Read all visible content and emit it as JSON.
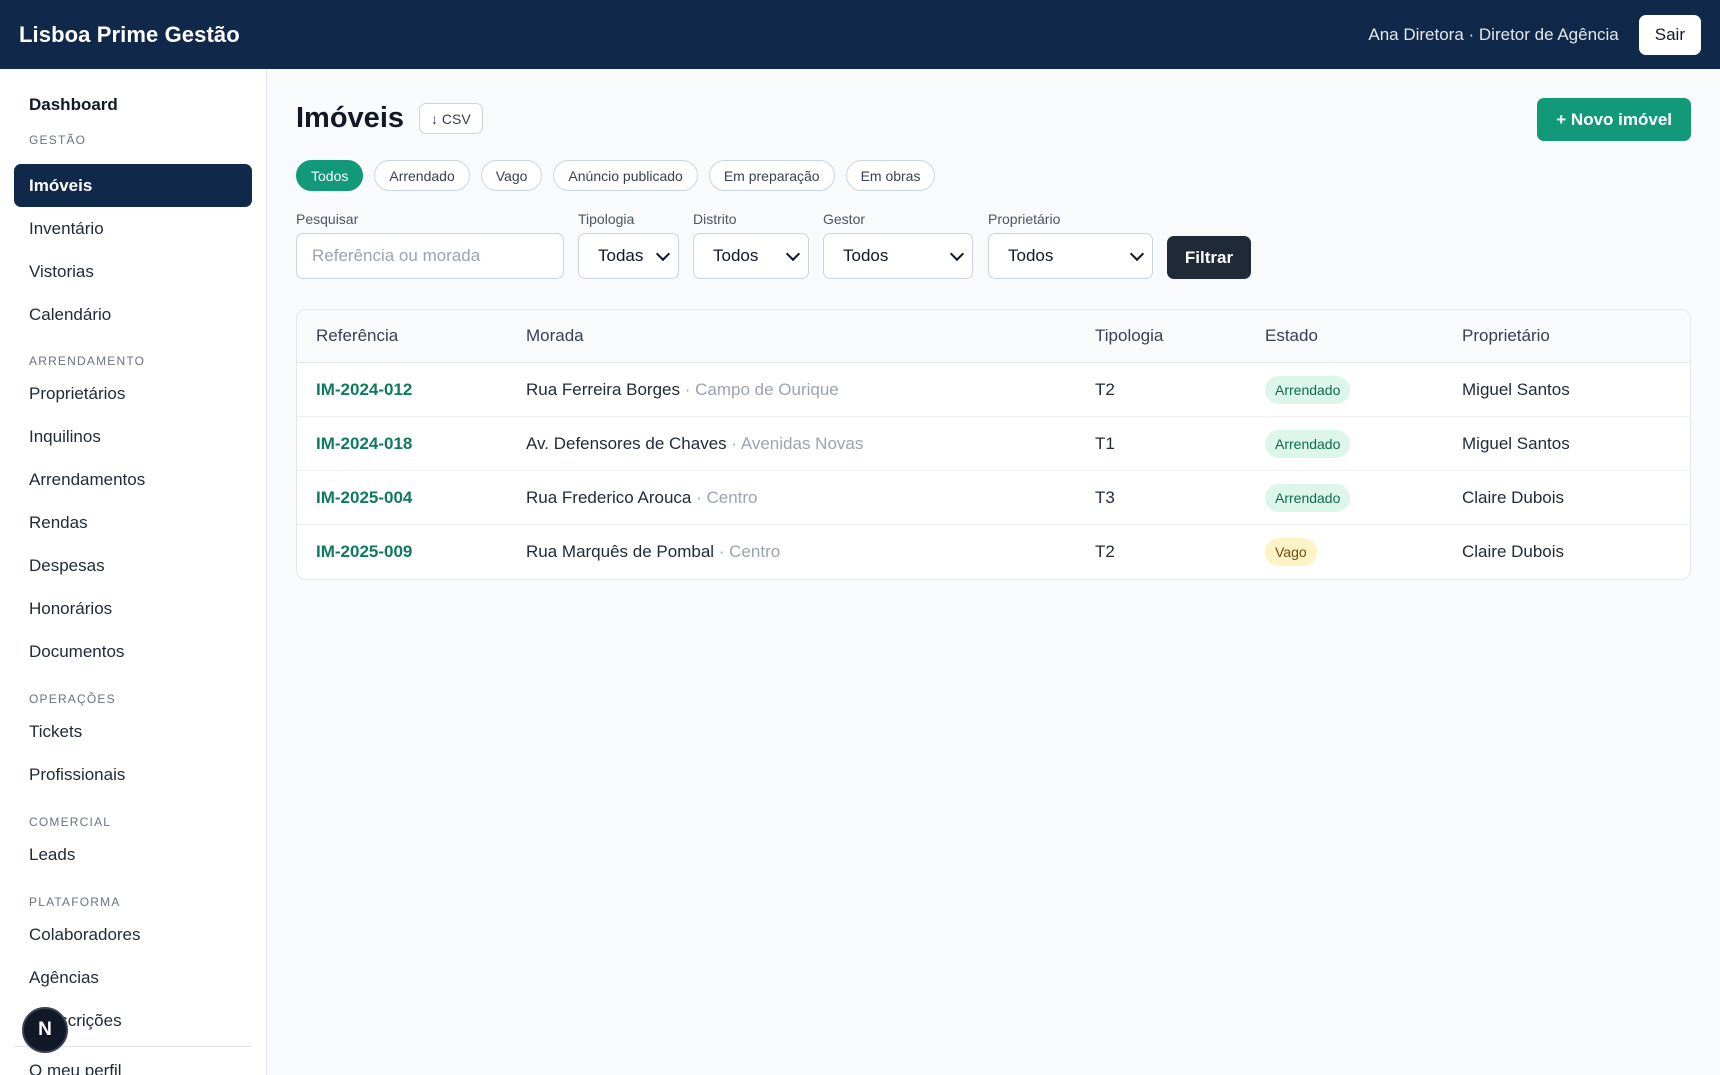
{
  "header": {
    "brand": "Lisboa Prime Gestão",
    "user": "Ana Diretora · Diretor de Agência",
    "logout_label": "Sair"
  },
  "sidebar": {
    "dashboard": "Dashboard",
    "sections": {
      "gestao": "GESTÃO",
      "arrendamento": "ARRENDAMENTO",
      "operacoes": "OPERAÇÕES",
      "comercial": "COMERCIAL",
      "plataforma": "PLATAFORMA"
    },
    "items": {
      "imoveis": "Imóveis",
      "inventario": "Inventário",
      "vistorias": "Vistorias",
      "calendario": "Calendário",
      "proprietarios": "Proprietários",
      "inquilinos": "Inquilinos",
      "arrendamentos": "Arrendamentos",
      "rendas": "Rendas",
      "despesas": "Despesas",
      "honorarios": "Honorários",
      "documentos": "Documentos",
      "tickets": "Tickets",
      "profissionais": "Profissionais",
      "leads": "Leads",
      "colaboradores": "Colaboradores",
      "agencias": "Agências",
      "subscricoes": "Subscrições",
      "perfil": "O meu perfil"
    },
    "badge": "N"
  },
  "main": {
    "title": "Imóveis",
    "csv_label": "↓ CSV",
    "new_label": "+ Novo imóvel",
    "chips": [
      "Todos",
      "Arrendado",
      "Vago",
      "Anúncio publicado",
      "Em preparação",
      "Em obras"
    ],
    "filters": {
      "search_label": "Pesquisar",
      "search_placeholder": "Referência ou morada",
      "tipologia_label": "Tipologia",
      "tipologia_value": "Todas",
      "distrito_label": "Distrito",
      "distrito_value": "Todos",
      "gestor_label": "Gestor",
      "gestor_value": "Todos",
      "proprietario_label": "Proprietário",
      "proprietario_value": "Todos",
      "submit_label": "Filtrar"
    },
    "table": {
      "headers": [
        "Referência",
        "Morada",
        "Tipologia",
        "Estado",
        "Proprietário"
      ],
      "rows": [
        {
          "ref": "IM-2024-012",
          "street": "Rua Ferreira Borges",
          "area": " · Campo de Ourique",
          "tipo": "T2",
          "estado": "Arrendado",
          "prop": "Miguel Santos"
        },
        {
          "ref": "IM-2024-018",
          "street": "Av. Defensores de Chaves",
          "area": " · Avenidas Novas",
          "tipo": "T1",
          "estado": "Arrendado",
          "prop": "Miguel Santos"
        },
        {
          "ref": "IM-2025-004",
          "street": "Rua Frederico Arouca",
          "area": " · Centro",
          "tipo": "T3",
          "estado": "Arrendado",
          "prop": "Claire Dubois"
        },
        {
          "ref": "IM-2025-009",
          "street": "Rua Marquês de Pombal",
          "area": " · Centro",
          "tipo": "T2",
          "estado": "Vago",
          "prop": "Claire Dubois"
        }
      ]
    }
  }
}
